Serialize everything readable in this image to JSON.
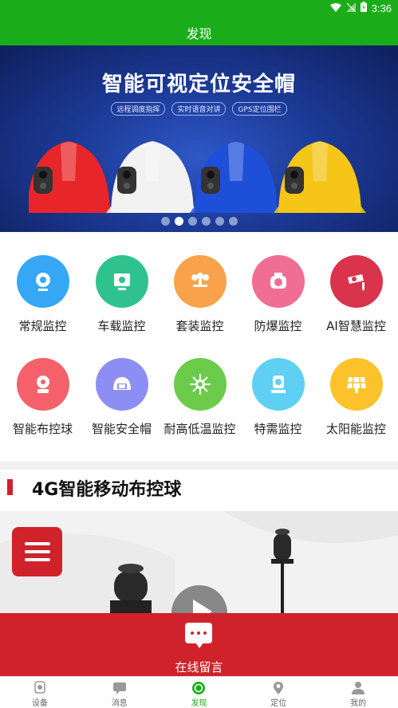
{
  "status_bar": {
    "time": "3:36"
  },
  "header": {
    "title": "发现"
  },
  "banner": {
    "title": "智能可视定位安全帽",
    "tags": [
      "远程调度指挥",
      "实时语音对讲",
      "GPS定位围栏"
    ],
    "helmet_colors": [
      "#e8262a",
      "#f2f2f2",
      "#1e4fd8",
      "#f5c518"
    ],
    "dots_count": 6,
    "active_dot": 2
  },
  "categories": [
    {
      "label": "常规监控",
      "color": "#35a7f5",
      "icon": "webcam-icon"
    },
    {
      "label": "车载监控",
      "color": "#2fc28f",
      "icon": "vehicle-monitor-icon"
    },
    {
      "label": "套装监控",
      "color": "#f9a24b",
      "icon": "camera-set-icon"
    },
    {
      "label": "防爆监控",
      "color": "#f06e93",
      "icon": "explosion-proof-camera-icon"
    },
    {
      "label": "AI智慧监控",
      "color": "#d9344c",
      "icon": "ai-camera-icon"
    },
    {
      "label": "智能布控球",
      "color": "#f4616b",
      "icon": "dome-camera-icon"
    },
    {
      "label": "智能安全帽",
      "color": "#8d8ef4",
      "icon": "helmet-icon"
    },
    {
      "label": "耐高低温监控",
      "color": "#6ccb4b",
      "icon": "temperature-icon"
    },
    {
      "label": "特需监控",
      "color": "#5fd0f3",
      "icon": "special-camera-icon"
    },
    {
      "label": "太阳能监控",
      "color": "#fcc22b",
      "icon": "solar-panel-icon"
    }
  ],
  "section": {
    "title": "4G智能移动布控球"
  },
  "online_message": {
    "label": "在线留言"
  },
  "tabs": [
    {
      "label": "设备",
      "icon": "device-icon"
    },
    {
      "label": "消息",
      "icon": "message-icon"
    },
    {
      "label": "发现",
      "icon": "discover-icon",
      "active": true
    },
    {
      "label": "定位",
      "icon": "location-icon"
    },
    {
      "label": "我的",
      "icon": "profile-icon"
    }
  ],
  "accent_color": "#1aad19",
  "brand_red": "#d0222a"
}
